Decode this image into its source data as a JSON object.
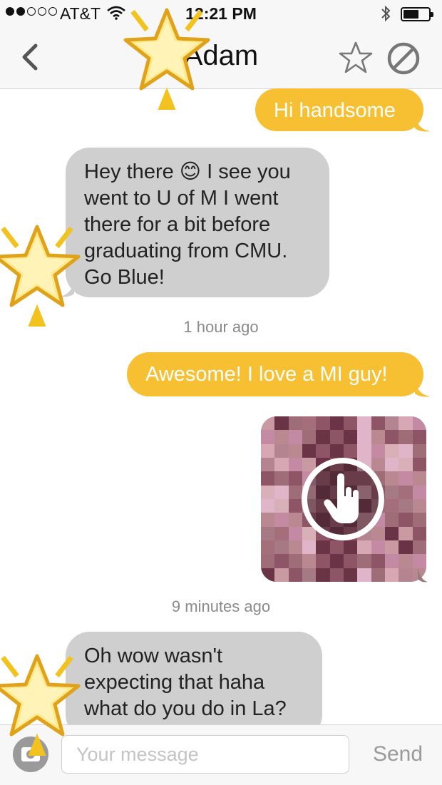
{
  "status_bar": {
    "carrier": "AT&T",
    "time": "12:21 PM",
    "signal_bars_filled": 2,
    "signal_bars_total": 5,
    "battery_level": 0.55,
    "icons": [
      "wifi-icon",
      "bluetooth-icon",
      "battery-icon"
    ]
  },
  "nav": {
    "title": "Adam",
    "icons": [
      "back-chevron-icon",
      "star-outline-icon",
      "block-icon"
    ]
  },
  "messages": [
    {
      "direction": "outgoing",
      "text": "Hi handsome"
    },
    {
      "direction": "incoming",
      "lines": [
        "Hey there 😊 I see you",
        "went to U of M I went",
        "there for a bit before",
        "graduating from CMU.",
        "Go Blue!"
      ]
    },
    {
      "type": "timestamp",
      "text": "1 hour ago"
    },
    {
      "direction": "outgoing",
      "text": "Awesome! I love a MI guy!"
    },
    {
      "direction": "outgoing",
      "type": "photo",
      "icon": "tap-hand-icon"
    },
    {
      "type": "timestamp",
      "text": "9 minutes ago"
    },
    {
      "direction": "incoming",
      "lines": [
        "Oh wow wasn't",
        "expecting that haha",
        "what do you do in La?"
      ]
    }
  ],
  "input_bar": {
    "placeholder": "Your message",
    "value": "",
    "send_label": "Send",
    "icons": [
      "camera-icon"
    ]
  },
  "colors": {
    "outgoing_bubble": "#f6c032",
    "incoming_bubble": "#cfcfcf",
    "timestamp_text": "#8a8a8a",
    "bar_background": "#f7f7f7"
  },
  "stickers": [
    "sparkle-star-icon",
    "sparkle-star-icon",
    "sparkle-star-icon",
    "sparkle-star-icon"
  ]
}
